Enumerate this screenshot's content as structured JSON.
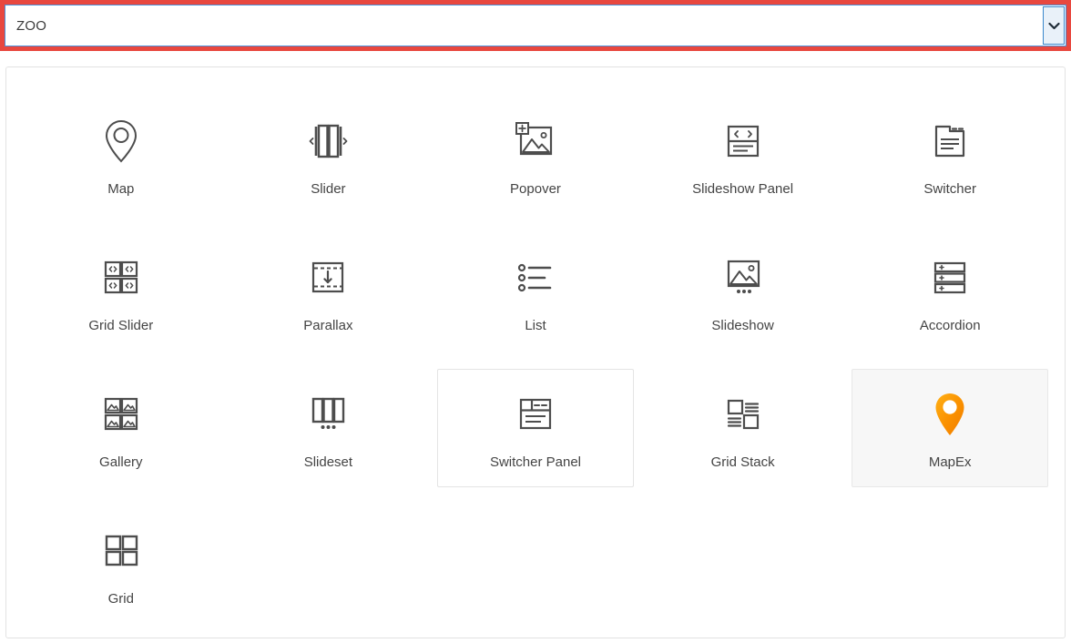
{
  "combobox": {
    "name": "widget-type-select",
    "value": "ZOO",
    "placeholder": "ZOO",
    "dropdown_icon": "chevron-down-icon",
    "invalid_ring_color": "#e8473f",
    "focus_border_color": "#4a90d9",
    "button_bg": "#e9f1f9"
  },
  "panel": {
    "border_color": "#e2e2e2",
    "selected_bg": "#f7f7f7",
    "accent_color": "#f59b0b",
    "icon_color": "#4d4d4d",
    "label_color": "#444444"
  },
  "widgets": [
    {
      "label": "Map",
      "icon": "map-pin-icon",
      "state": "normal"
    },
    {
      "label": "Slider",
      "icon": "slider-icon",
      "state": "normal"
    },
    {
      "label": "Popover",
      "icon": "popover-image-icon",
      "state": "normal"
    },
    {
      "label": "Slideshow Panel",
      "icon": "slideshow-panel-icon",
      "state": "normal"
    },
    {
      "label": "Switcher",
      "icon": "switcher-icon",
      "state": "normal"
    },
    {
      "label": "Grid Slider",
      "icon": "grid-slider-icon",
      "state": "normal"
    },
    {
      "label": "Parallax",
      "icon": "parallax-icon",
      "state": "normal"
    },
    {
      "label": "List",
      "icon": "list-icon",
      "state": "normal"
    },
    {
      "label": "Slideshow",
      "icon": "slideshow-icon",
      "state": "normal"
    },
    {
      "label": "Accordion",
      "icon": "accordion-icon",
      "state": "normal"
    },
    {
      "label": "Gallery",
      "icon": "gallery-icon",
      "state": "normal"
    },
    {
      "label": "Slideset",
      "icon": "slideset-icon",
      "state": "normal"
    },
    {
      "label": "Switcher Panel",
      "icon": "switcher-panel-icon",
      "state": "outlined"
    },
    {
      "label": "Grid Stack",
      "icon": "grid-stack-icon",
      "state": "normal"
    },
    {
      "label": "MapEx",
      "icon": "mapex-pin-icon",
      "state": "selected"
    },
    {
      "label": "Grid",
      "icon": "grid-icon",
      "state": "normal"
    }
  ]
}
